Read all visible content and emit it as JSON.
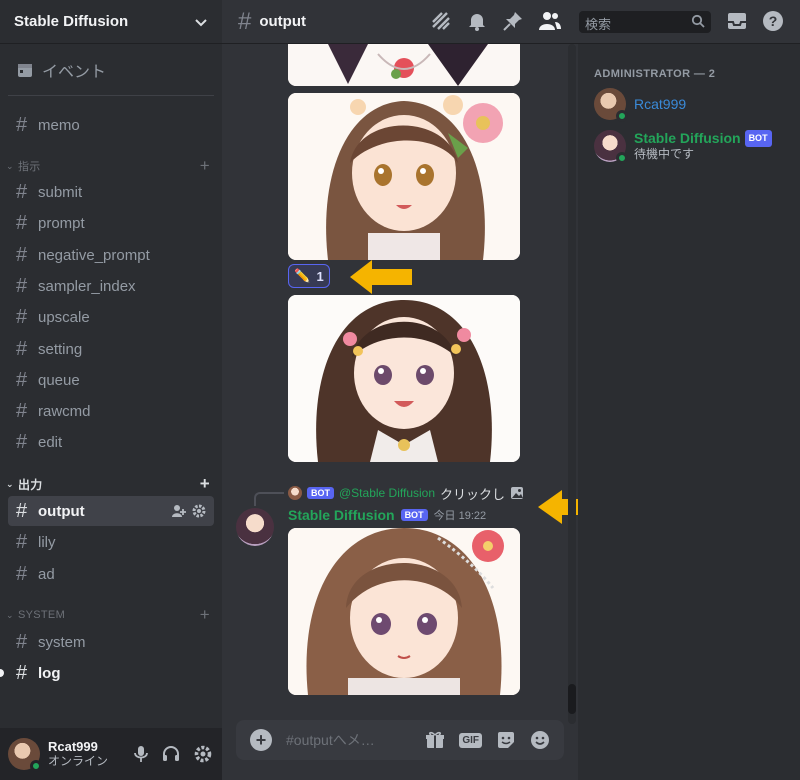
{
  "server": {
    "name": "Stable Diffusion"
  },
  "events_label": "イベント",
  "channels_top": [
    {
      "name": "memo"
    }
  ],
  "categories": {
    "instructions": "指示",
    "output": "出力",
    "system": "SYSTEM"
  },
  "instruction_channels": [
    "submit",
    "prompt",
    "negative_prompt",
    "sampler_index",
    "upscale",
    "setting",
    "queue",
    "rawcmd",
    "edit"
  ],
  "output_channels": [
    "output",
    "lily",
    "ad"
  ],
  "system_channels": [
    "system",
    "log"
  ],
  "current_user": {
    "name": "Rcat999",
    "status": "オンライン"
  },
  "topbar": {
    "channel": "output",
    "search_placeholder": "検索"
  },
  "chat": {
    "reaction": {
      "emoji": "✏️",
      "count": "1"
    },
    "reply": {
      "bot_tag": "BOT",
      "mention": "@Stable Diffusion",
      "text": "クリックし"
    },
    "message": {
      "author": "Stable Diffusion",
      "bot_tag": "BOT",
      "time": "今日 19:22"
    },
    "composer_placeholder": "#outputへメ…"
  },
  "members": {
    "group_label": "ADMINISTRATOR — 2",
    "list": [
      {
        "name": "Rcat999",
        "sub": ""
      },
      {
        "name": "Stable Diffusion",
        "bot_tag": "BOT",
        "sub": "待機中です"
      }
    ]
  },
  "colors": {
    "accent": "#5865f2",
    "online": "#23a55a",
    "arrow": "#f5b400",
    "link_name": "#3a8ad8"
  }
}
